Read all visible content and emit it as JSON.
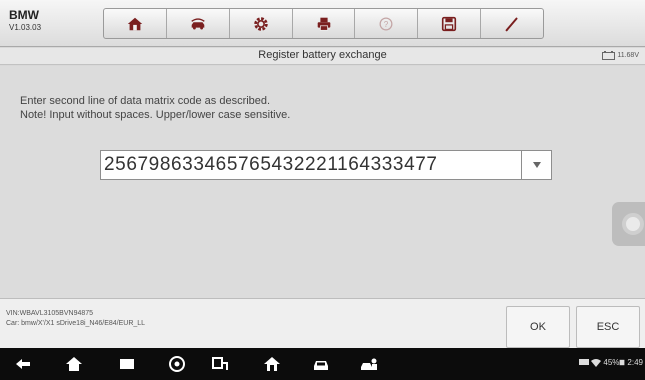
{
  "app": {
    "name": "BMW",
    "version": "V1.03.03"
  },
  "toolbar": {
    "icons": [
      "home-icon",
      "vehicle-swap-icon",
      "settings-icon",
      "print-icon",
      "help-icon",
      "save-icon",
      "edit-icon"
    ]
  },
  "header": {
    "title": "Register battery exchange",
    "battery_voltage": "11.68V"
  },
  "main": {
    "instruction_line1": "Enter second line of data matrix code as described.",
    "instruction_line2": "Note! Input without spaces. Upper/lower case sensitive.",
    "code_value": "256798633465765432221164333477"
  },
  "footer": {
    "vin": "VIN:WBAVL3105BVN94875",
    "car": "Car: bmw/X'/X1 sDrive18i_N46/E84/EUR_LL",
    "ok_label": "OK",
    "esc_label": "ESC"
  },
  "status_bar": {
    "battery": "45%",
    "time": "2:49"
  },
  "colors": {
    "toolbar_icon": "#7a1f1f",
    "nav_icon": "#ffffff"
  }
}
